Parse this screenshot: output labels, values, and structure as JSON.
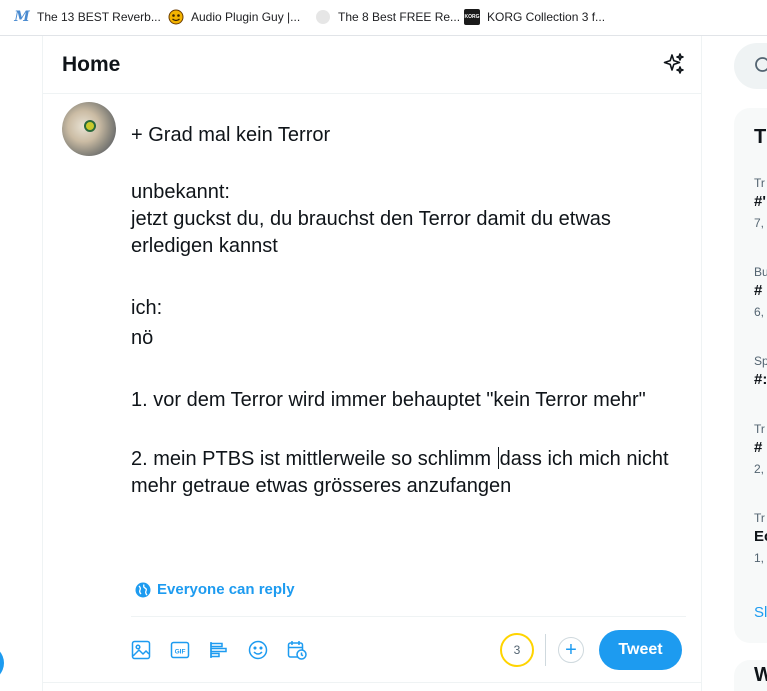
{
  "bookmarks": [
    {
      "label": "The 13 BEST Reverb...",
      "icon": "m-script-icon"
    },
    {
      "label": "Audio Plugin Guy |...",
      "icon": "emoji-face-icon"
    },
    {
      "label": "The 8 Best FREE Re...",
      "icon": "moon-logo-icon"
    },
    {
      "label": "KORG Collection 3 f...",
      "icon": "korg-logo-icon",
      "icon_text": "KORG"
    }
  ],
  "header": {
    "title": "Home"
  },
  "compose": {
    "lines": [
      "+ Grad mal kein Terror",
      "",
      "unbekannt:",
      "jetzt guckst du, du brauchst den Terror damit du etwas erledigen kannst",
      "",
      "ich:",
      "nö",
      "",
      "1. vor dem Terror wird immer behauptet \"kein Terror mehr\"",
      "",
      "2. mein PTBS ist mittlerweile so schlimm",
      "dass ich mich nicht mehr getraue etwas grösseres anzufangen"
    ],
    "reply_setting": "Everyone can reply",
    "char_counter": "3",
    "tweet_label": "Tweet"
  },
  "sidebar": {
    "trends_title": "T",
    "trends": [
      {
        "meta": "Tr",
        "name": "#'",
        "count": "7,"
      },
      {
        "meta": "Bu",
        "name": "#",
        "count": "6,"
      },
      {
        "meta": "Sp",
        "name": "#:",
        "count": ""
      },
      {
        "meta": "Tr",
        "name": "#",
        "count": "2,"
      },
      {
        "meta": "Tr",
        "name": "Ec",
        "count": "1,"
      }
    ],
    "show_more": "Sl",
    "who_title": "W"
  },
  "colors": {
    "accent": "#1d9bf0",
    "counter_ring": "#ffd400",
    "text": "#0f1419",
    "muted": "#536471"
  }
}
